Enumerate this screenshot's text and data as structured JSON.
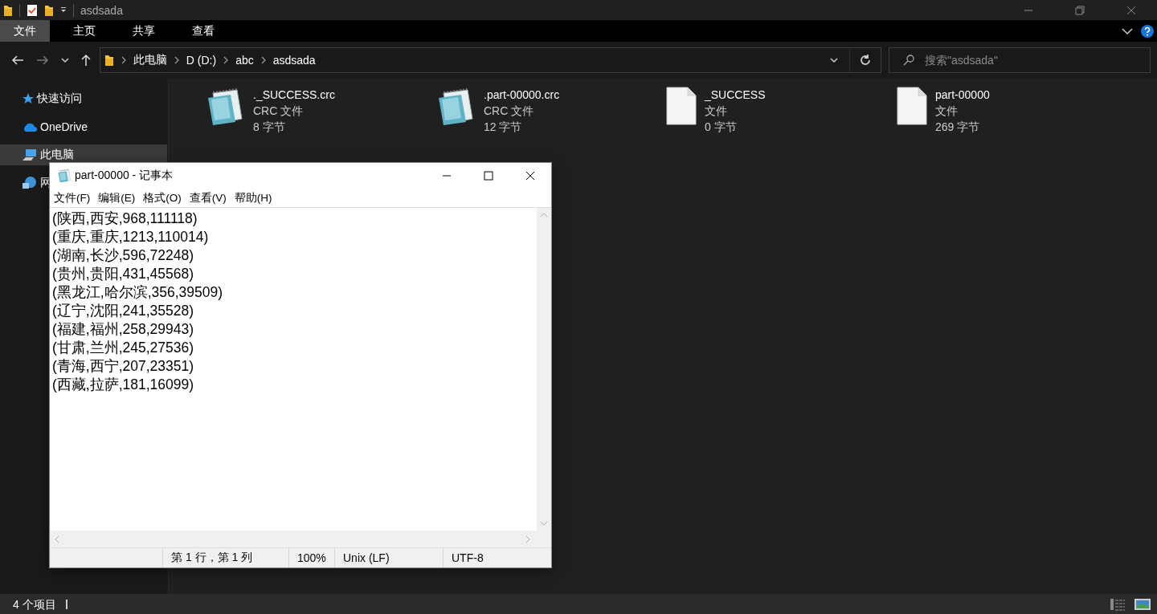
{
  "explorer": {
    "title": "asdsada",
    "ribbon_tabs": [
      {
        "label": "文件",
        "selected": true
      },
      {
        "label": "主页",
        "selected": false
      },
      {
        "label": "共享",
        "selected": false
      },
      {
        "label": "查看",
        "selected": false
      }
    ],
    "breadcrumb": [
      "此电脑",
      "D (D:)",
      "abc",
      "asdsada"
    ],
    "search": {
      "placeholder": "搜索\"asdsada\""
    },
    "sidebar": {
      "items": [
        {
          "label": "快速访问",
          "kind": "star",
          "selected": false
        },
        {
          "label": "OneDrive",
          "kind": "cloud",
          "selected": false
        },
        {
          "label": "此电脑",
          "kind": "pc",
          "selected": true
        },
        {
          "label": "网",
          "kind": "network",
          "selected": false
        }
      ]
    },
    "files": [
      {
        "name": "._SUCCESS.crc",
        "type": "CRC 文件",
        "size": "8 字节",
        "kind": "notepad"
      },
      {
        "name": ".part-00000.crc",
        "type": "CRC 文件",
        "size": "12 字节",
        "kind": "notepad"
      },
      {
        "name": "_SUCCESS",
        "type": "文件",
        "size": "0 字节",
        "kind": "blank"
      },
      {
        "name": "part-00000",
        "type": "文件",
        "size": "269 字节",
        "kind": "blank"
      }
    ],
    "status_bar": {
      "count": "4 个项目"
    }
  },
  "notepad": {
    "title": "part-00000 - 记事本",
    "menu": [
      "文件(F)",
      "编辑(E)",
      "格式(O)",
      "查看(V)",
      "帮助(H)"
    ],
    "lines": [
      "(陕西,西安,968,111118)",
      "(重庆,重庆,1213,110014)",
      "(湖南,长沙,596,72248)",
      "(贵州,贵阳,431,45568)",
      "(黑龙江,哈尔滨,356,39509)",
      "(辽宁,沈阳,241,35528)",
      "(福建,福州,258,29943)",
      "(甘肃,兰州,245,27536)",
      "(青海,西宁,207,23351)",
      "(西藏,拉萨,181,16099)"
    ],
    "status": [
      "第 1 行，第 1 列",
      "100%",
      "Unix (LF)",
      "UTF-8"
    ]
  }
}
